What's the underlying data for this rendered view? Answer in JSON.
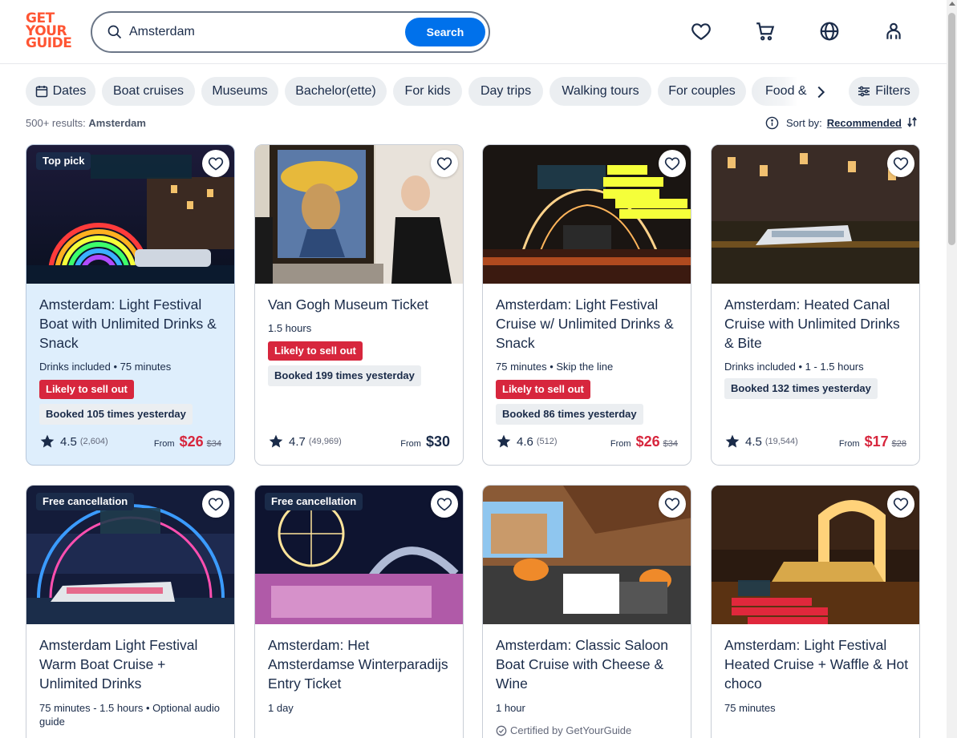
{
  "header": {
    "logo": [
      "GET",
      "YOUR",
      "GUIDE"
    ],
    "search_value": "Amsterdam",
    "search_button": "Search",
    "icons": [
      "heart-icon",
      "cart-icon",
      "globe-icon",
      "account-icon"
    ]
  },
  "chips": {
    "items": [
      "Dates",
      "Boat cruises",
      "Museums",
      "Bachelor(ette)",
      "For kids",
      "Day trips",
      "Walking tours",
      "For couples"
    ],
    "partial": "Food & drink",
    "filters": "Filters"
  },
  "results": {
    "count": "500+ results:",
    "location": "Amsterdam"
  },
  "sort": {
    "label": "Sort by:",
    "value": "Recommended"
  },
  "cards": [
    {
      "tag": "Top pick",
      "title": "Amsterdam: Light Festival Boat with Unlimited Drinks & Snack",
      "meta": "Drinks included • 75 minutes",
      "likely": "Likely to sell out",
      "booked": "Booked 105 times yesterday",
      "rating": "4.5",
      "reviews": "(2,604)",
      "from": "From",
      "price": "$26",
      "was": "$34"
    },
    {
      "title": "Van Gogh Museum Ticket",
      "meta": "1.5 hours",
      "likely": "Likely to sell out",
      "booked": "Booked 199 times yesterday",
      "rating": "4.7",
      "reviews": "(49,969)",
      "from": "From",
      "price": "$30"
    },
    {
      "title": "Amsterdam: Light Festival Cruise w/ Unlimited Drinks & Snack",
      "meta": "75 minutes • Skip the line",
      "likely": "Likely to sell out",
      "booked": "Booked 86 times yesterday",
      "rating": "4.6",
      "reviews": "(512)",
      "from": "From",
      "price": "$26",
      "was": "$34"
    },
    {
      "title": "Amsterdam: Heated Canal Cruise with Unlimited Drinks & Bite",
      "meta": "Drinks included • 1 - 1.5 hours",
      "booked": "Booked 132 times yesterday",
      "rating": "4.5",
      "reviews": "(19,544)",
      "from": "From",
      "price": "$17",
      "was": "$28"
    },
    {
      "tag": "Free cancellation",
      "title": "Amsterdam Light Festival Warm Boat Cruise + Unlimited Drinks",
      "meta": "75 minutes - 1.5 hours • Optional audio guide"
    },
    {
      "tag": "Free cancellation",
      "title": "Amsterdam: Het Amsterdamse Winterparadijs Entry Ticket",
      "meta": "1 day"
    },
    {
      "title": "Amsterdam: Classic Saloon Boat Cruise with Cheese & Wine",
      "meta": "1 hour",
      "certified": "Certified by GetYourGuide"
    },
    {
      "title": "Amsterdam: Light Festival Heated Cruise + Waffle & Hot choco",
      "meta": "75 minutes"
    }
  ],
  "colors": {
    "brand": "#ff5533",
    "accent": "#0071eb",
    "sale": "#d7263d",
    "text": "#1a2b49",
    "highlight": "#deeefc"
  }
}
